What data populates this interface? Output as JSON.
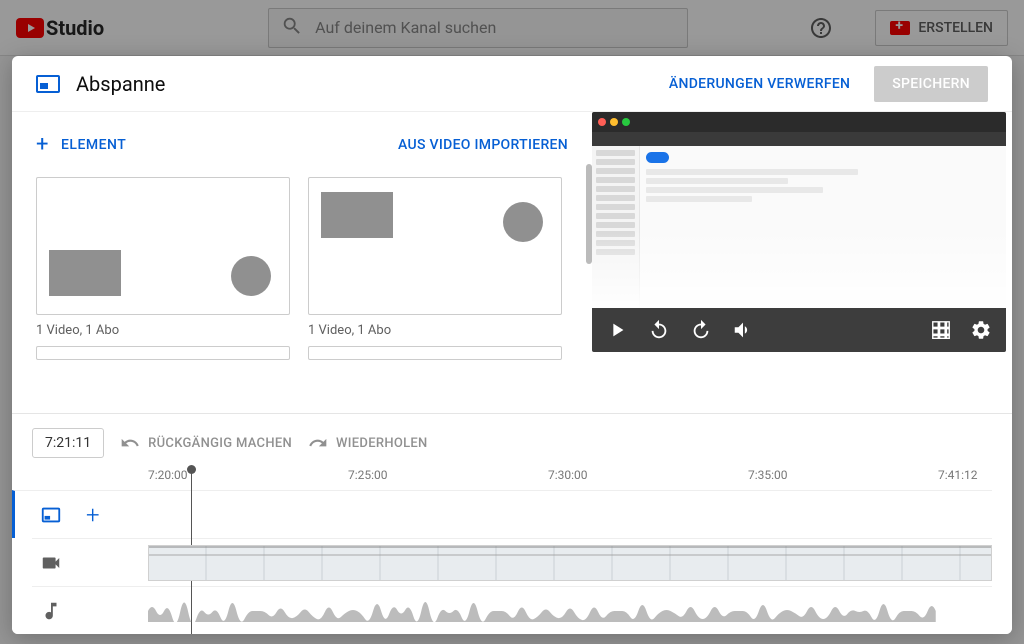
{
  "topbar": {
    "logo_text": "Studio",
    "search_placeholder": "Auf deinem Kanal suchen",
    "create_label": "ERSTELLEN"
  },
  "modal": {
    "title": "Abspanne",
    "discard_label": "ÄNDERUNGEN VERWERFEN",
    "save_label": "SPEICHERN",
    "element_label": "ELEMENT",
    "import_label": "AUS VIDEO IMPORTIEREN",
    "templates": [
      {
        "label": "1 Video, 1 Abo"
      },
      {
        "label": "1 Video, 1 Abo"
      }
    ]
  },
  "timeline": {
    "current_time": "7:21:11",
    "undo_label": "RÜCKGÄNGIG MACHEN",
    "redo_label": "WIEDERHOLEN",
    "ticks": [
      "7:20:00",
      "7:25:00",
      "7:30:00",
      "7:35:00",
      "7:41:12"
    ]
  }
}
